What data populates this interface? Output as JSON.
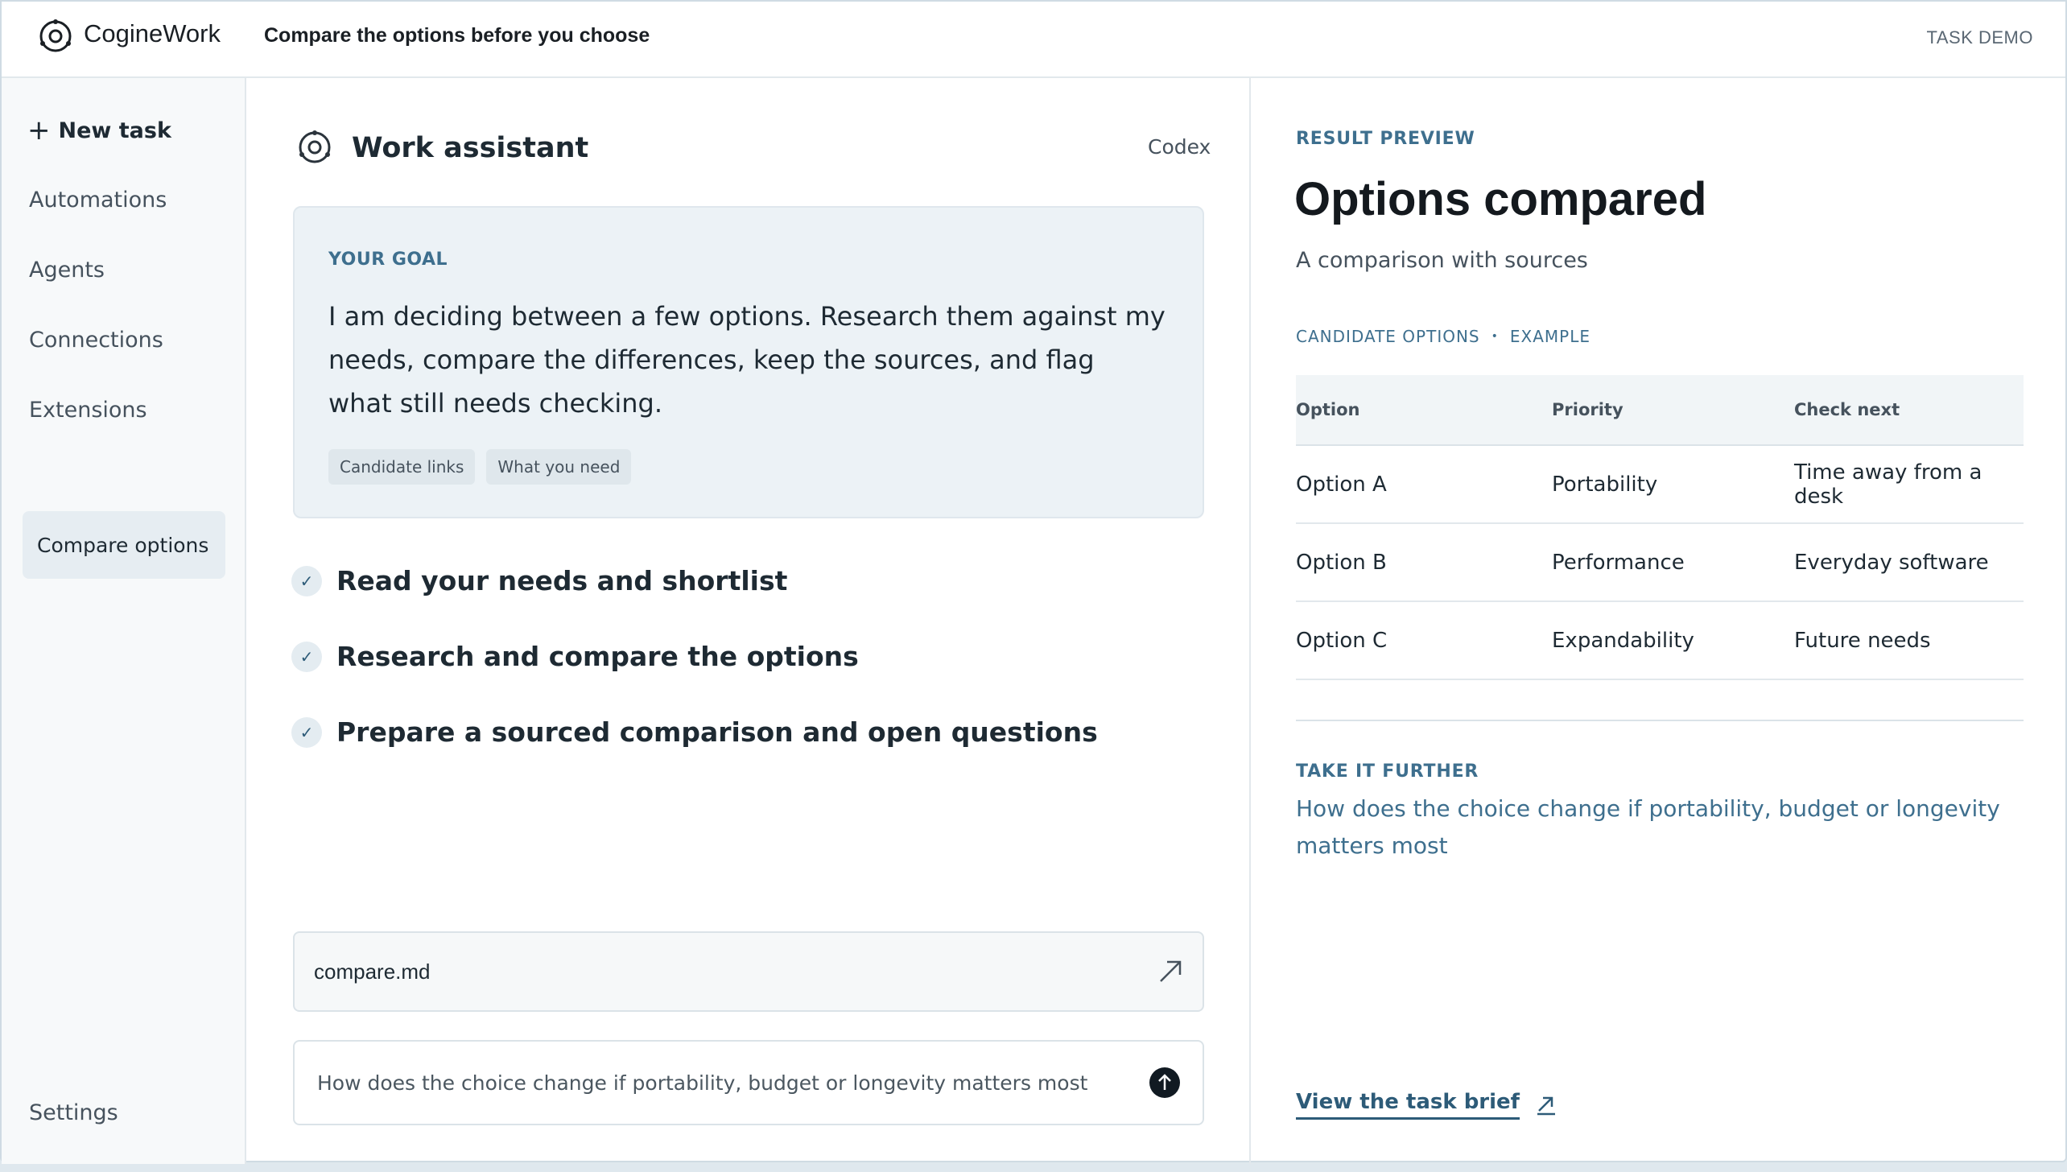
{
  "app": {
    "brand": "CogineWork",
    "page_heading": "Compare the options before you choose",
    "task_demo_label": "TASK DEMO"
  },
  "sidebar": {
    "new_task_label": "New task",
    "items": [
      {
        "label": "Automations"
      },
      {
        "label": "Agents"
      },
      {
        "label": "Connections"
      },
      {
        "label": "Extensions"
      }
    ],
    "active_item": "Compare options",
    "settings_label": "Settings"
  },
  "assistant": {
    "title": "Work assistant",
    "model_label": "Codex"
  },
  "goal": {
    "label": "YOUR GOAL",
    "text": "I am deciding between a few options. Research them against my needs, compare the differences, keep the sources, and flag what still needs checking.",
    "chips": [
      "Candidate links",
      "What you need"
    ]
  },
  "steps": [
    {
      "label": "Read your needs and shortlist",
      "icon": "check-icon"
    },
    {
      "label": "Research and compare the options",
      "icon": "check-icon"
    },
    {
      "label": "Prepare a sourced comparison and open questions",
      "icon": "check-icon"
    }
  ],
  "file": {
    "name": "compare.md",
    "icon": "open-external-icon"
  },
  "prompt": {
    "text": "How does the choice change if portability, budget or longevity matters most",
    "send_icon": "arrow-up-icon"
  },
  "result": {
    "eyebrow": "RESULT PREVIEW",
    "title": "Options compared",
    "subtitle": "A comparison with sources",
    "table_label": "CANDIDATE OPTIONS",
    "table_tag": "EXAMPLE",
    "table_separator": "•",
    "columns": [
      "Option",
      "Priority",
      "Check next"
    ],
    "rows": [
      [
        "Option A",
        "Portability",
        "Time away from a desk"
      ],
      [
        "Option B",
        "Performance",
        "Everyday software"
      ],
      [
        "Option C",
        "Expandability",
        "Future needs"
      ]
    ],
    "further_label": "TAKE IT FURTHER",
    "further_text": "How does the choice change if portability, budget or longevity matters most",
    "brief_link": "View the task brief"
  },
  "colors": {
    "accent": "#3e6f8e",
    "link": "#2d5b78",
    "active_nav_bg": "#e6edf2",
    "goal_card_bg": "#ecf2f6"
  }
}
